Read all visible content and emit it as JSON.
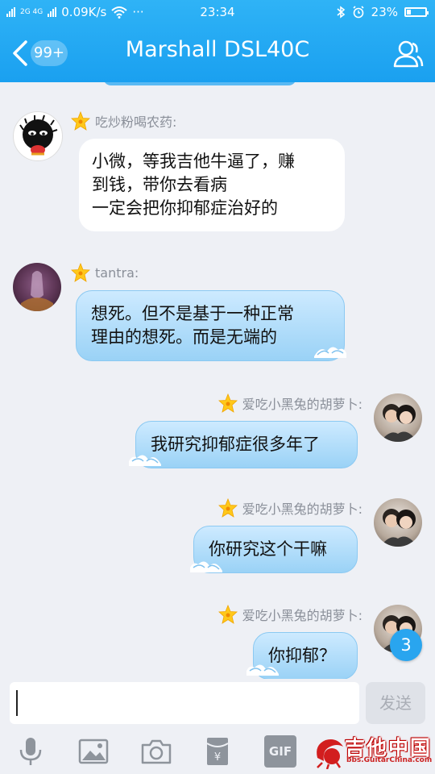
{
  "status": {
    "network_label": "2G 4G",
    "speed": "0.09K/s",
    "dots": "···",
    "time": "23:34",
    "battery": "23%"
  },
  "header": {
    "unread_count": "99+",
    "title": "Marshall DSL40C"
  },
  "messages": [
    {
      "side": "left",
      "nick": "吃炒粉喝农药:",
      "text": "小微，等我吉他牛逼了，赚\n到钱，带你去看病\n一定会把你抑郁症治好的",
      "style": "white"
    },
    {
      "side": "left",
      "nick": "tantra:",
      "text": "想死。但不是基于一种正常\n理由的想死。而是无端的",
      "style": "blue"
    },
    {
      "side": "right",
      "nick": "爱吃小黑兔的胡萝卜:",
      "text": "我研究抑郁症很多年了",
      "style": "blue"
    },
    {
      "side": "right",
      "nick": "爱吃小黑兔的胡萝卜:",
      "text": "你研究这个干嘛",
      "style": "blue"
    },
    {
      "side": "right",
      "nick": "爱吃小黑兔的胡萝卜:",
      "text": "你抑郁？",
      "style": "blue"
    }
  ],
  "scroll_badge": "3",
  "input": {
    "value": "",
    "send_label": "发送"
  },
  "toolbar": {
    "gif_label": "GIF"
  },
  "watermark": {
    "main": "吉他中国",
    "sub": "bbs.GuitarChina.com"
  },
  "colors": {
    "header": "#1aa0f0",
    "accent": "#29a5ef",
    "bubble_blue": "#9ad2f6"
  }
}
